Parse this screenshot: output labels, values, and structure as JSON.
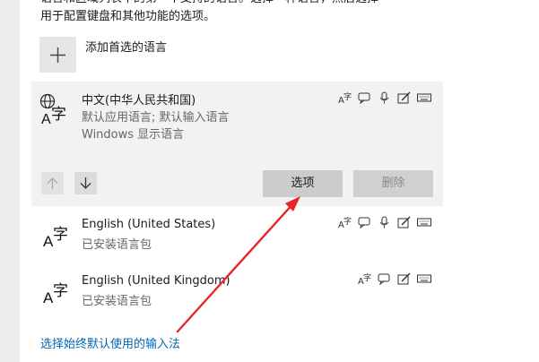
{
  "intro": {
    "line1": "语言和区域列表中的第一个支持的语言。选择一种语言，然后选择",
    "line2": "用于配置键盘和其他功能的选项。"
  },
  "add_language": {
    "label": "添加首选的语言",
    "icon": "plus-icon"
  },
  "languages": [
    {
      "name": "中文(中华人民共和国)",
      "sub1": "默认应用语言; 默认输入语言",
      "sub2": "Windows 显示语言",
      "features": [
        "handwriting-icon",
        "speech-bubble-icon",
        "microphone-icon",
        "pen-icon",
        "keyboard-icon"
      ]
    },
    {
      "name": "English (United States)",
      "sub1": "已安装语言包",
      "features": [
        "handwriting-icon",
        "speech-bubble-icon",
        "microphone-icon",
        "pen-icon",
        "keyboard-icon"
      ]
    },
    {
      "name": "English (United Kingdom)",
      "sub1": "已安装语言包",
      "features": [
        "handwriting-icon",
        "speech-bubble-icon",
        "pen-icon",
        "keyboard-icon"
      ]
    }
  ],
  "buttons": {
    "options": "选项",
    "remove": "删除"
  },
  "link": "选择始终默认使用的输入法",
  "colors": {
    "selected_bg": "#f2f2f2",
    "button_bg": "#cccccc",
    "link": "#0066b4",
    "annotation": "#e8262a"
  }
}
